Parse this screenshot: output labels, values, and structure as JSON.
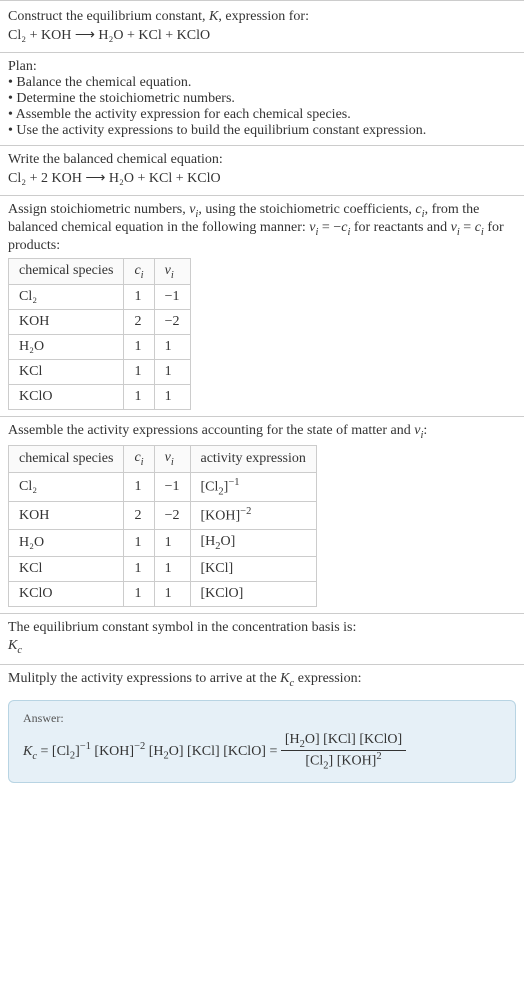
{
  "s1": {
    "title": "Construct the equilibrium constant, K, expression for:",
    "eq": "Cl₂ + KOH ⟶ H₂O + KCl + KClO"
  },
  "s2": {
    "title": "Plan:",
    "b1": "• Balance the chemical equation.",
    "b2": "• Determine the stoichiometric numbers.",
    "b3": "• Assemble the activity expression for each chemical species.",
    "b4": "• Use the activity expressions to build the equilibrium constant expression."
  },
  "s3": {
    "title": "Write the balanced chemical equation:",
    "eq": "Cl₂ + 2 KOH ⟶ H₂O + KCl + KClO"
  },
  "s4": {
    "text": "Assign stoichiometric numbers, νᵢ, using the stoichiometric coefficients, cᵢ, from the balanced chemical equation in the following manner: νᵢ = −cᵢ for reactants and νᵢ = cᵢ for products:",
    "h1": "chemical species",
    "h2": "cᵢ",
    "h3": "νᵢ",
    "rows": [
      {
        "a": "Cl₂",
        "b": "1",
        "c": "−1"
      },
      {
        "a": "KOH",
        "b": "2",
        "c": "−2"
      },
      {
        "a": "H₂O",
        "b": "1",
        "c": "1"
      },
      {
        "a": "KCl",
        "b": "1",
        "c": "1"
      },
      {
        "a": "KClO",
        "b": "1",
        "c": "1"
      }
    ]
  },
  "s5": {
    "text": "Assemble the activity expressions accounting for the state of matter and νᵢ:",
    "h1": "chemical species",
    "h2": "cᵢ",
    "h3": "νᵢ",
    "h4": "activity expression",
    "rows": [
      {
        "a": "Cl₂",
        "b": "1",
        "c": "−1",
        "d": "[Cl₂]⁻¹"
      },
      {
        "a": "KOH",
        "b": "2",
        "c": "−2",
        "d": "[KOH]⁻²"
      },
      {
        "a": "H₂O",
        "b": "1",
        "c": "1",
        "d": "[H₂O]"
      },
      {
        "a": "KCl",
        "b": "1",
        "c": "1",
        "d": "[KCl]"
      },
      {
        "a": "KClO",
        "b": "1",
        "c": "1",
        "d": "[KClO]"
      }
    ]
  },
  "s6": {
    "text": "The equilibrium constant symbol in the concentration basis is:",
    "sym": "K",
    "symsub": "c"
  },
  "s7": {
    "text": "Mulitply the activity expressions to arrive at the Kc expression:"
  },
  "ans": {
    "label": "Answer:",
    "lhs": "Kc = [Cl₂]⁻¹ [KOH]⁻² [H₂O] [KCl] [KClO] = ",
    "num": "[H₂O] [KCl] [KClO]",
    "den": "[Cl₂] [KOH]²"
  },
  "chart_data": {
    "type": "table",
    "tables": [
      {
        "title": "Stoichiometric numbers",
        "columns": [
          "chemical species",
          "cᵢ",
          "νᵢ"
        ],
        "rows": [
          [
            "Cl₂",
            1,
            -1
          ],
          [
            "KOH",
            2,
            -2
          ],
          [
            "H₂O",
            1,
            1
          ],
          [
            "KCl",
            1,
            1
          ],
          [
            "KClO",
            1,
            1
          ]
        ]
      },
      {
        "title": "Activity expressions",
        "columns": [
          "chemical species",
          "cᵢ",
          "νᵢ",
          "activity expression"
        ],
        "rows": [
          [
            "Cl₂",
            1,
            -1,
            "[Cl₂]^-1"
          ],
          [
            "KOH",
            2,
            -2,
            "[KOH]^-2"
          ],
          [
            "H₂O",
            1,
            1,
            "[H₂O]"
          ],
          [
            "KCl",
            1,
            1,
            "[KCl]"
          ],
          [
            "KClO",
            1,
            1,
            "[KClO]"
          ]
        ]
      }
    ]
  }
}
